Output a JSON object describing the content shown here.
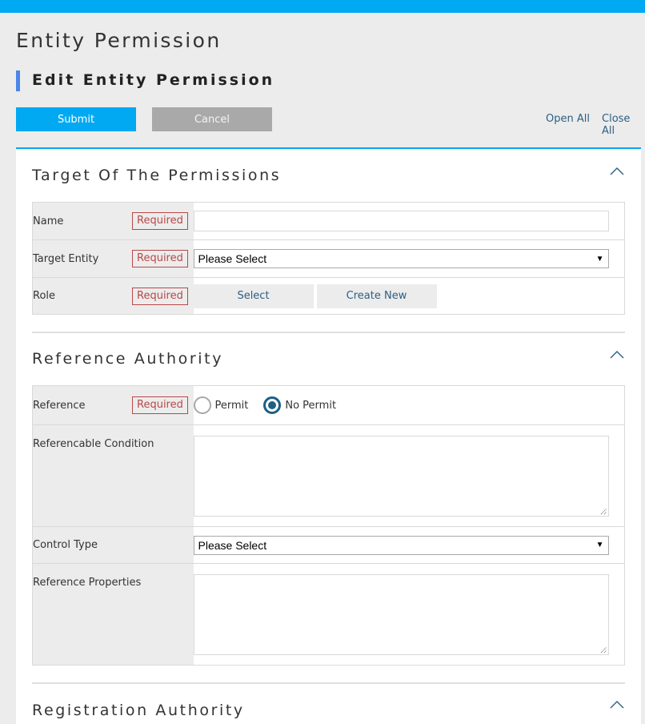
{
  "header": {
    "page_title": "Entity Permission",
    "sub_title": "Edit Entity Permission"
  },
  "toolbar": {
    "submit_label": "Submit",
    "cancel_label": "Cancel",
    "open_all_label": "Open All",
    "close_all_label": "Close All"
  },
  "colors": {
    "accent": "#00a9f2",
    "sub_title_bar": "#4a86e8",
    "required": "#b84848",
    "link": "#2c5f83",
    "radio_checked": "#1e5f86"
  },
  "sections": [
    {
      "title": "Target Of The Permissions",
      "collapse_icon": "chevron-up-icon",
      "rows": [
        {
          "label": "Name",
          "required": "Required",
          "type": "text",
          "value": ""
        },
        {
          "label": "Target Entity",
          "required": "Required",
          "type": "select",
          "value": "Please Select"
        },
        {
          "label": "Role",
          "required": "Required",
          "type": "buttons",
          "buttons": [
            "Select",
            "Create New"
          ]
        }
      ]
    },
    {
      "title": "Reference Authority",
      "collapse_icon": "chevron-up-icon",
      "rows": [
        {
          "label": "Reference",
          "required": "Required",
          "type": "radio",
          "options": [
            "Permit",
            "No Permit"
          ],
          "selected": "No Permit"
        },
        {
          "label": "Referencable Condition",
          "type": "textarea",
          "value": ""
        },
        {
          "label": "Control Type",
          "type": "select",
          "value": "Please Select"
        },
        {
          "label": "Reference Properties",
          "type": "textarea",
          "value": ""
        }
      ]
    },
    {
      "title": "Registration Authority",
      "collapse_icon": "chevron-up-icon"
    }
  ]
}
